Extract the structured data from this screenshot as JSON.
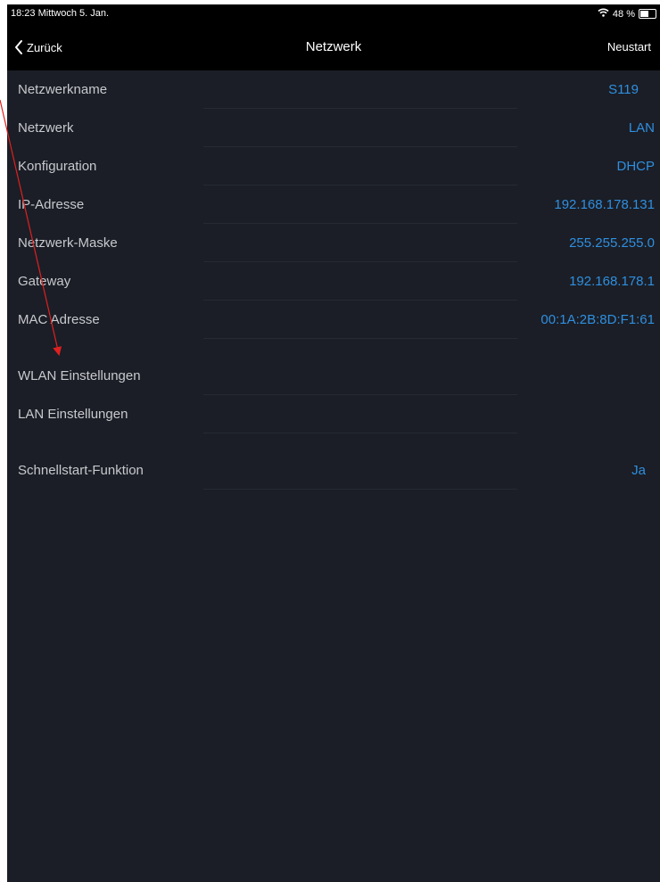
{
  "status_bar": {
    "time_date": "18:23  Mittwoch 5. Jan.",
    "battery": "48 %",
    "battery_level": 0.48
  },
  "nav": {
    "back_label": "Zurück",
    "title": "Netzwerk",
    "restart_label": "Neustart"
  },
  "rows": [
    {
      "label": "Netzwerkname",
      "value": "S119"
    },
    {
      "label": "Netzwerk",
      "value": "LAN"
    },
    {
      "label": "Konfiguration",
      "value": "DHCP"
    },
    {
      "label": "IP-Adresse",
      "value": "192.168.178.131"
    },
    {
      "label": "Netzwerk-Maske",
      "value": "255.255.255.0"
    },
    {
      "label": "Gateway",
      "value": "192.168.178.1"
    },
    {
      "label": "MAC Adresse",
      "value": "00:1A:2B:8D:F1:61"
    }
  ],
  "settings": [
    {
      "label": "WLAN Einstellungen"
    },
    {
      "label": "LAN Einstellungen"
    }
  ],
  "quickstart": {
    "label": "Schnellstart-Funktion",
    "value": "Ja"
  },
  "colors": {
    "accent": "#2f8fe0",
    "annotation": "#e02020",
    "background": "#1b1e26"
  },
  "icons": {
    "back": "chevron-left-icon",
    "wifi": "wifi-icon",
    "battery": "battery-icon",
    "annotation": "red-arrow-annotation"
  }
}
